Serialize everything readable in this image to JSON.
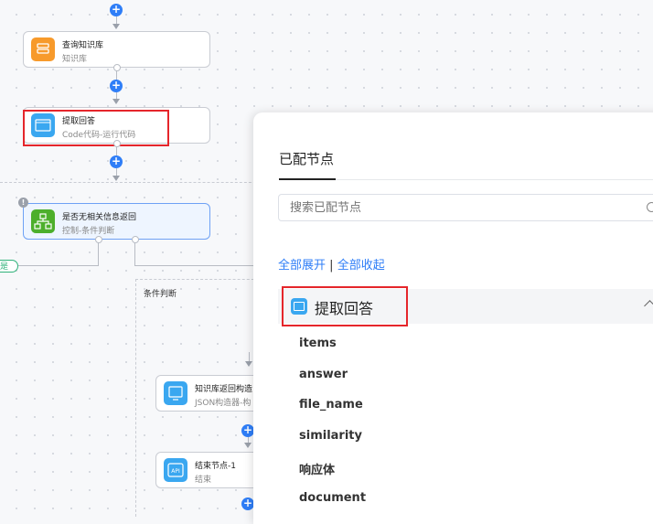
{
  "canvas": {
    "nodes": [
      {
        "title": "查询知识库",
        "subtitle": "知识库",
        "icon": "database-icon",
        "color": "#f79a2b"
      },
      {
        "title": "提取回答",
        "subtitle": "Code代码-运行代码",
        "icon": "code-icon",
        "color": "#3aa7f0"
      },
      {
        "title": "是否无相关信息返回",
        "subtitle": "控制-条件判断",
        "icon": "branch-icon",
        "color": "#4caf2c"
      },
      {
        "title": "知识库返回构造",
        "subtitle": "JSON构造器-构",
        "icon": "json-icon",
        "color": "#3aa7f0"
      },
      {
        "title": "结束节点-1",
        "subtitle": "结束",
        "icon": "api-icon",
        "color": "#3aa7f0"
      }
    ],
    "yes_label": "是",
    "condition_group_label": "条件判断",
    "warning_glyph": "!"
  },
  "panel": {
    "title": "已配节点",
    "search_placeholder": "搜索已配节点",
    "expand_all": "全部展开",
    "separator": "|",
    "collapse_all": "全部收起",
    "group": {
      "label": "提取回答",
      "icon": "code-icon",
      "fields": [
        "items",
        "answer",
        "file_name",
        "similarity",
        "响应体",
        "document"
      ]
    }
  },
  "colors": {
    "accent": "#2f7ef7",
    "highlight": "#e5262b",
    "yes_green": "#2fb27a"
  }
}
